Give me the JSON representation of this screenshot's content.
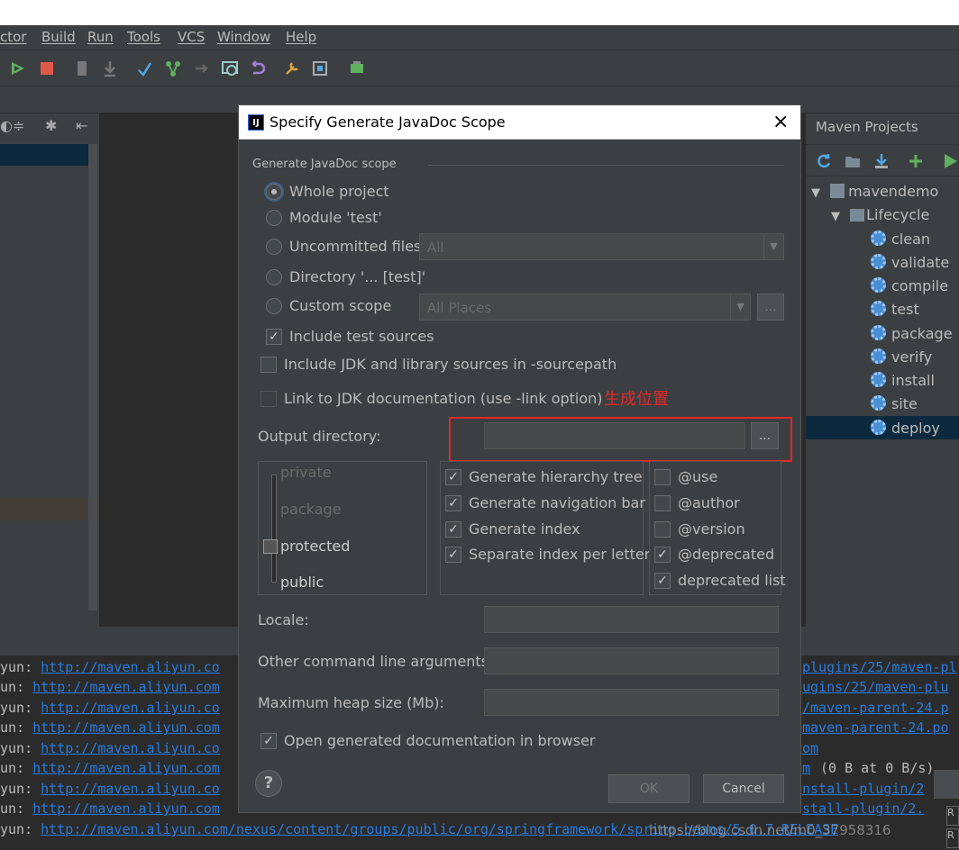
{
  "menu": {
    "items": [
      "ctor",
      "Build",
      "Run",
      "Tools",
      "VCS",
      "Window",
      "Help"
    ]
  },
  "maven": {
    "title": "Maven Projects",
    "project": "mavendemo",
    "lifecycle_label": "Lifecycle",
    "lifecycle": [
      "clean",
      "validate",
      "compile",
      "test",
      "package",
      "verify",
      "install",
      "site",
      "deploy"
    ],
    "selected": "deploy"
  },
  "dialog": {
    "title": "Specify Generate JavaDoc Scope",
    "close_glyph": "×",
    "group_label": "Generate JavaDoc scope",
    "scope": {
      "whole_project": "Whole project",
      "module": "Module 'test'",
      "uncommitted": "Uncommitted files",
      "uncommitted_combo": "All",
      "directory": "Directory '... [test]'",
      "custom": "Custom scope",
      "custom_combo": "All Places",
      "browse": "..."
    },
    "include_test": "Include test sources",
    "include_jdk": "Include JDK and library sources in -sourcepath",
    "link_jdk": "Link to JDK documentation (use -link option)",
    "annotation": "生成位置",
    "output_label": "Output directory:",
    "output_value": "",
    "output_browse": "...",
    "visibility": [
      "private",
      "package",
      "protected",
      "public"
    ],
    "generate": [
      "Generate hierarchy tree",
      "Generate navigation bar",
      "Generate index",
      "Separate index per letter"
    ],
    "tags": [
      "@use",
      "@author",
      "@version",
      "@deprecated",
      "deprecated list"
    ],
    "locale_label": "Locale:",
    "other_args_label": "Other command line arguments:",
    "heap_label": "Maximum heap size (Mb):",
    "open_browser": "Open generated documentation in browser",
    "help": "?",
    "ok": "OK",
    "cancel": "Cancel"
  },
  "console": {
    "prefixes": [
      "yun: ",
      "un: ",
      "yun: ",
      "un: ",
      "yun: ",
      "un: ",
      "yun: ",
      "un: ",
      "yun: "
    ],
    "links_left": [
      "http://maven.aliyun.co",
      "http://maven.aliyun.com",
      "http://maven.aliyun.co",
      "http://maven.aliyun.com",
      "http://maven.aliyun.co",
      "http://maven.aliyun.com",
      "http://maven.aliyun.co",
      "http://maven.aliyun.com"
    ],
    "links_right": [
      "plugins/25/maven-pl",
      "ugins/25/maven-plu",
      "/maven-parent-24.p",
      "maven-parent-24.po",
      "om",
      "m",
      "nstall-plugin/2",
      "stall-plugin/2."
    ],
    "transfer_note": " (0 B at 0 B/s)",
    "last_link": "http://maven.aliyun.com/nexus/content/groups/public/org/springframework/spring-beans/5.0.7.RELEASE",
    "watermark": "https://blog.csdn.net/m0_37958316",
    "side_button": "R"
  }
}
